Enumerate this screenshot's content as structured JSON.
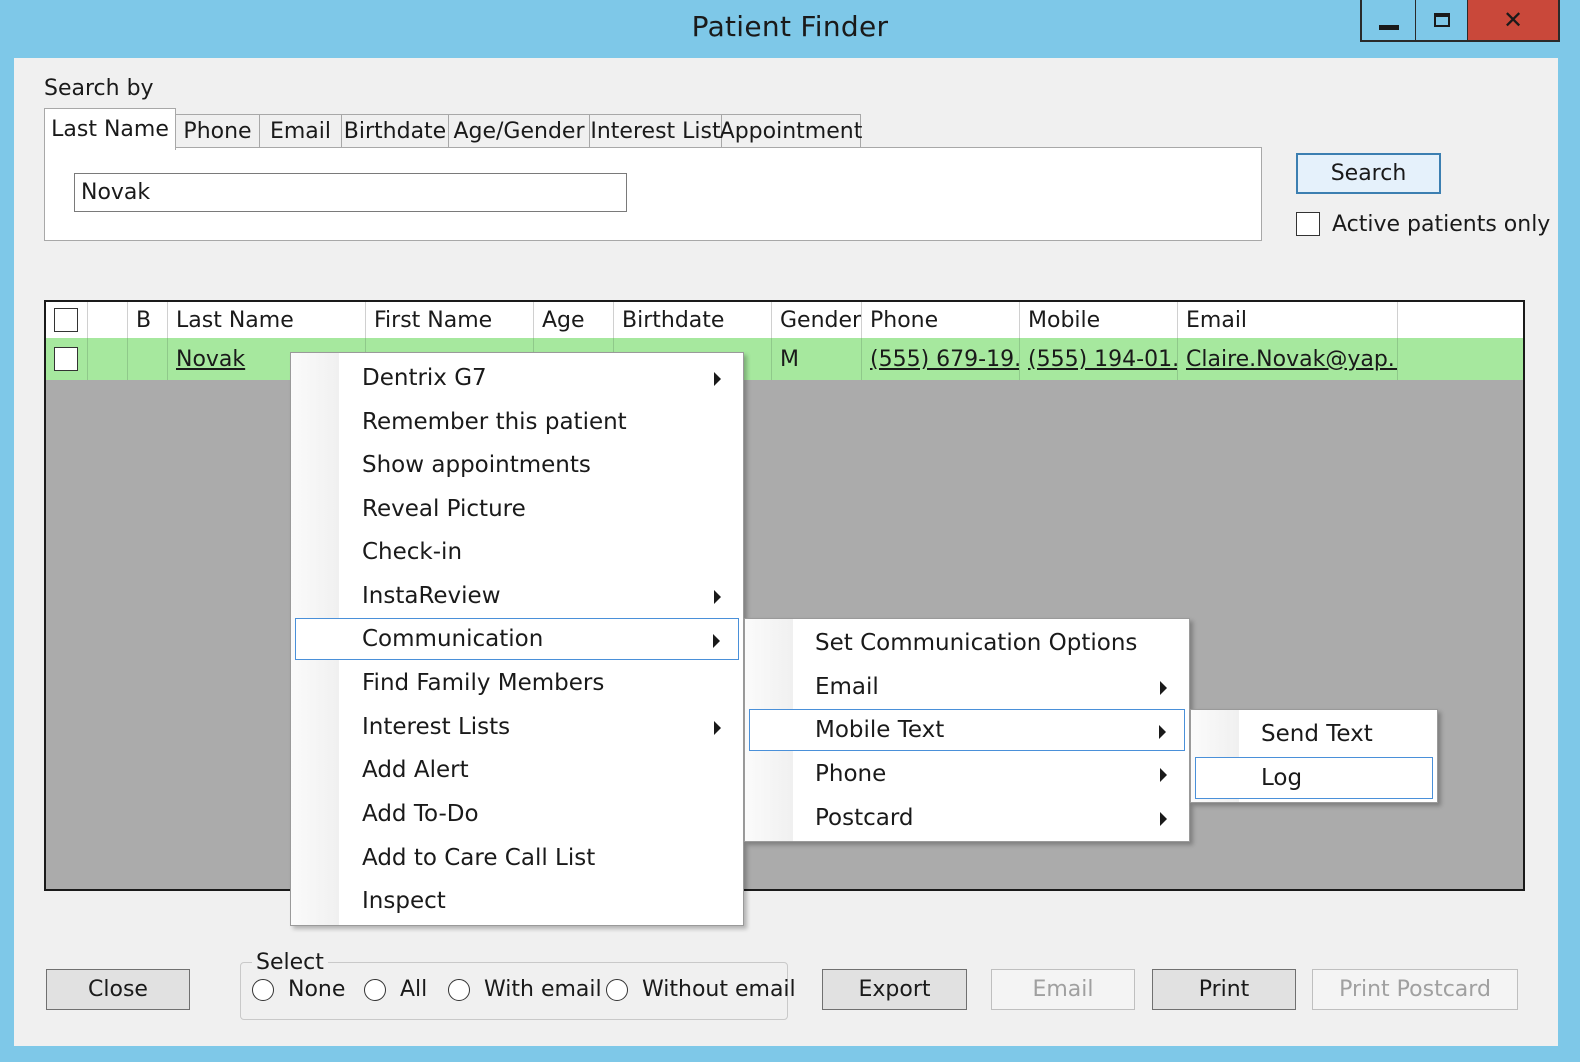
{
  "window": {
    "title": "Patient Finder"
  },
  "search": {
    "section_label": "Search by",
    "tabs": [
      "Last Name",
      "Phone",
      "Email",
      "Birthdate",
      "Age/Gender",
      "Interest List",
      "Appointment"
    ],
    "active_tab": "Last Name",
    "query_value": "Novak",
    "search_button": "Search",
    "active_only_label": "Active patients only",
    "active_only_checked": false
  },
  "grid": {
    "columns": [
      "",
      "",
      "B",
      "Last Name",
      "First Name",
      "Age",
      "Birthdate",
      "Gender",
      "Phone",
      "Mobile",
      "Email"
    ],
    "rows": [
      {
        "last_name": "Novak",
        "gender": "M",
        "phone": "(555) 679-19...",
        "mobile": "(555) 194-01...",
        "email": "Claire.Novak@yap..."
      }
    ],
    "row_color": "#a6e89e"
  },
  "context_menu": {
    "items": [
      {
        "label": "Dentrix G7",
        "submenu": true
      },
      {
        "label": "Remember this patient",
        "submenu": false
      },
      {
        "label": "Show appointments",
        "submenu": false
      },
      {
        "label": "Reveal Picture",
        "submenu": false
      },
      {
        "label": "Check-in",
        "submenu": false
      },
      {
        "label": "InstaReview",
        "submenu": true
      },
      {
        "label": "Communication",
        "submenu": true,
        "highlighted": true
      },
      {
        "label": "Find Family Members",
        "submenu": false
      },
      {
        "label": "Interest Lists",
        "submenu": true
      },
      {
        "label": "Add Alert",
        "submenu": false
      },
      {
        "label": "Add To-Do",
        "submenu": false
      },
      {
        "label": "Add to Care Call List",
        "submenu": false
      },
      {
        "label": "Inspect",
        "submenu": false
      }
    ]
  },
  "communication_submenu": {
    "items": [
      {
        "label": "Set Communication Options",
        "submenu": false
      },
      {
        "label": "Email",
        "submenu": true
      },
      {
        "label": "Mobile Text",
        "submenu": true,
        "highlighted": true
      },
      {
        "label": "Phone",
        "submenu": true
      },
      {
        "label": "Postcard",
        "submenu": true
      }
    ]
  },
  "mobile_text_submenu": {
    "items": [
      {
        "label": "Send Text"
      },
      {
        "label": "Log",
        "highlighted": true
      }
    ]
  },
  "footer": {
    "close_button": "Close",
    "select_group_label": "Select",
    "select_options": [
      "None",
      "All",
      "With email",
      "Without email"
    ],
    "export_button": "Export",
    "email_button": "Email",
    "print_button": "Print",
    "print_postcard_button": "Print Postcard"
  },
  "colors": {
    "titlebar": "#7ec8e8",
    "close_button": "#c9483a",
    "highlight_border": "#4a90d9"
  }
}
